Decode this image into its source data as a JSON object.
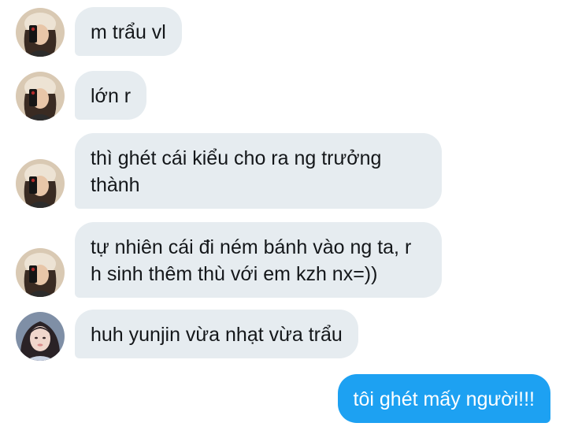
{
  "conversation": {
    "messages": [
      {
        "sender": "other",
        "text": "m trẩu vl"
      },
      {
        "sender": "other",
        "text": "lớn r"
      },
      {
        "sender": "other",
        "text": "thì ghét cái kiểu cho ra ng trưởng thành"
      },
      {
        "sender": "other",
        "text": "tự nhiên cái đi ném bánh vào ng ta, r h sinh thêm thù với em kzh nx=))"
      },
      {
        "sender": "other",
        "text": "huh yunjin vừa nhạt vừa trẩu"
      },
      {
        "sender": "me",
        "text": "tôi ghét mấy người!!!"
      }
    ]
  },
  "colors": {
    "incoming_bubble": "#e6ecf0",
    "outgoing_bubble": "#1da1f2",
    "incoming_text": "#14171a",
    "outgoing_text": "#ffffff"
  }
}
